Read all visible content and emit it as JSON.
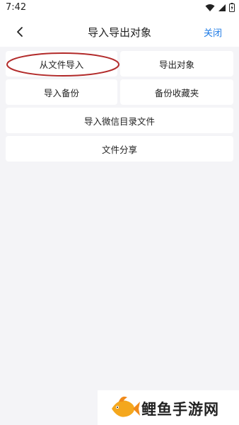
{
  "status": {
    "time": "7:42"
  },
  "header": {
    "title": "导入导出对象",
    "close_label": "关闭"
  },
  "menu": {
    "import_from_file": "从文件导入",
    "export_objects": "导出对象",
    "import_backup": "导入备份",
    "backup_favorites": "备份收藏夹",
    "import_wechat_dir": "导入微信目录文件",
    "file_share": "文件分享"
  },
  "watermark": {
    "text": "鲤鱼手游网"
  },
  "colors": {
    "accent": "#1e7be6",
    "highlight_oval": "#b22a2a",
    "background": "#f4f4f7"
  }
}
